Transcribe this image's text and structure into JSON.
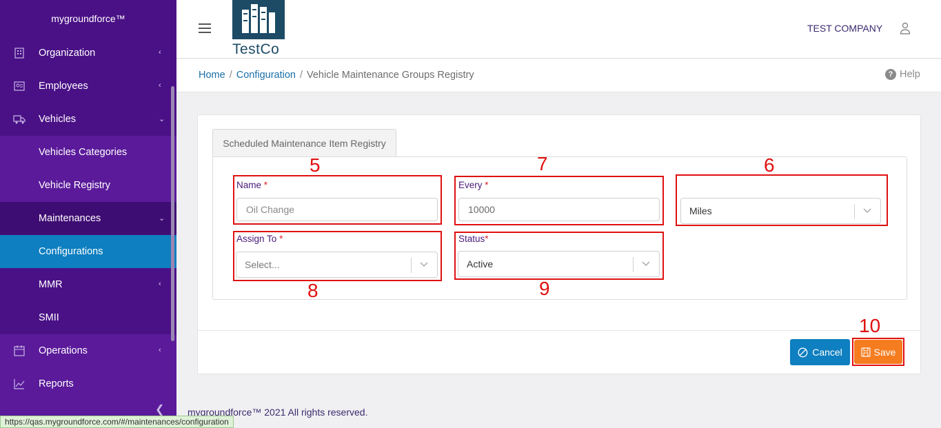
{
  "app": {
    "brand": "mygroundforce™"
  },
  "sidebar": {
    "items": [
      {
        "label": "Organization",
        "icon": "building-icon"
      },
      {
        "label": "Employees",
        "icon": "id-card-icon"
      },
      {
        "label": "Vehicles",
        "icon": "truck-icon"
      },
      {
        "label": "Vehicles Categories"
      },
      {
        "label": "Vehicle Registry"
      },
      {
        "label": "Maintenances"
      },
      {
        "label": "Configurations"
      },
      {
        "label": "MMR"
      },
      {
        "label": "SMII"
      },
      {
        "label": "Operations",
        "icon": "calendar-icon"
      },
      {
        "label": "Reports",
        "icon": "chart-line-icon"
      }
    ]
  },
  "header": {
    "logo_text": "TestCo",
    "company": "TEST COMPANY"
  },
  "breadcrumb": {
    "home": "Home",
    "configuration": "Configuration",
    "current": "Vehicle Maintenance Groups Registry",
    "help": "Help"
  },
  "form": {
    "tab": "Scheduled Maintenance Item Registry",
    "name_label": "Name",
    "name_placeholder": "Oil Change",
    "every_label": "Every",
    "every_value": "10000",
    "unit_value": "Miles",
    "assign_label": "Assign To",
    "assign_placeholder": "Select...",
    "status_label": "Status",
    "status_value": "Active",
    "required_mark": "*"
  },
  "annotations": {
    "a5": "5",
    "a6": "6",
    "a7": "7",
    "a8": "8",
    "a9": "9",
    "a10": "10"
  },
  "actions": {
    "cancel": "Cancel",
    "save": "Save"
  },
  "footer": {
    "copyright": "mygroundforce™ 2021 All rights reserved."
  },
  "status_bar": {
    "url": "https://qas.mygroundforce.com/#/maintenances/configuration"
  },
  "colors": {
    "sidebar": "#5a1a9a",
    "active": "#0e7fc0",
    "save": "#f57c1f",
    "annotation": "#e01010"
  }
}
